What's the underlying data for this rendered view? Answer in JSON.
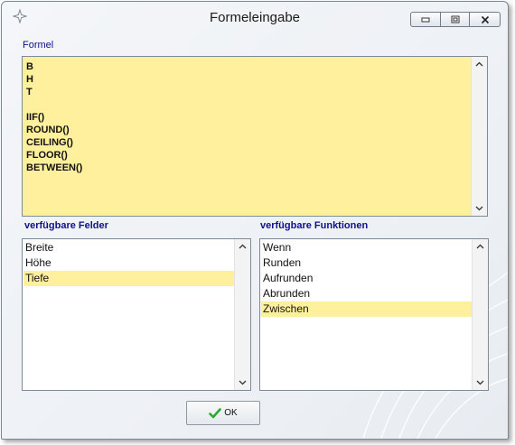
{
  "window": {
    "title": "Formeleingabe"
  },
  "formula": {
    "label": "Formel",
    "lines": [
      "B",
      "H",
      "T",
      "",
      "IIF()",
      "ROUND()",
      "CEILING()",
      "FLOOR()",
      "BETWEEN()"
    ],
    "background": "#fff09d"
  },
  "fields": {
    "label": "verfügbare Felder",
    "items": [
      "Breite",
      "Höhe",
      "Tiefe"
    ],
    "selected": "Tiefe"
  },
  "functions": {
    "label": "verfügbare Funktionen",
    "items": [
      "Wenn",
      "Runden",
      "Aufrunden",
      "Abrunden",
      "Zwischen"
    ],
    "selected": "Zwischen"
  },
  "ok_button": {
    "label": "OK",
    "icon": "checkmark-icon"
  },
  "colors": {
    "label_text": "#10108a",
    "selection": "#fff09d",
    "ok_check": "#2fa82f"
  }
}
